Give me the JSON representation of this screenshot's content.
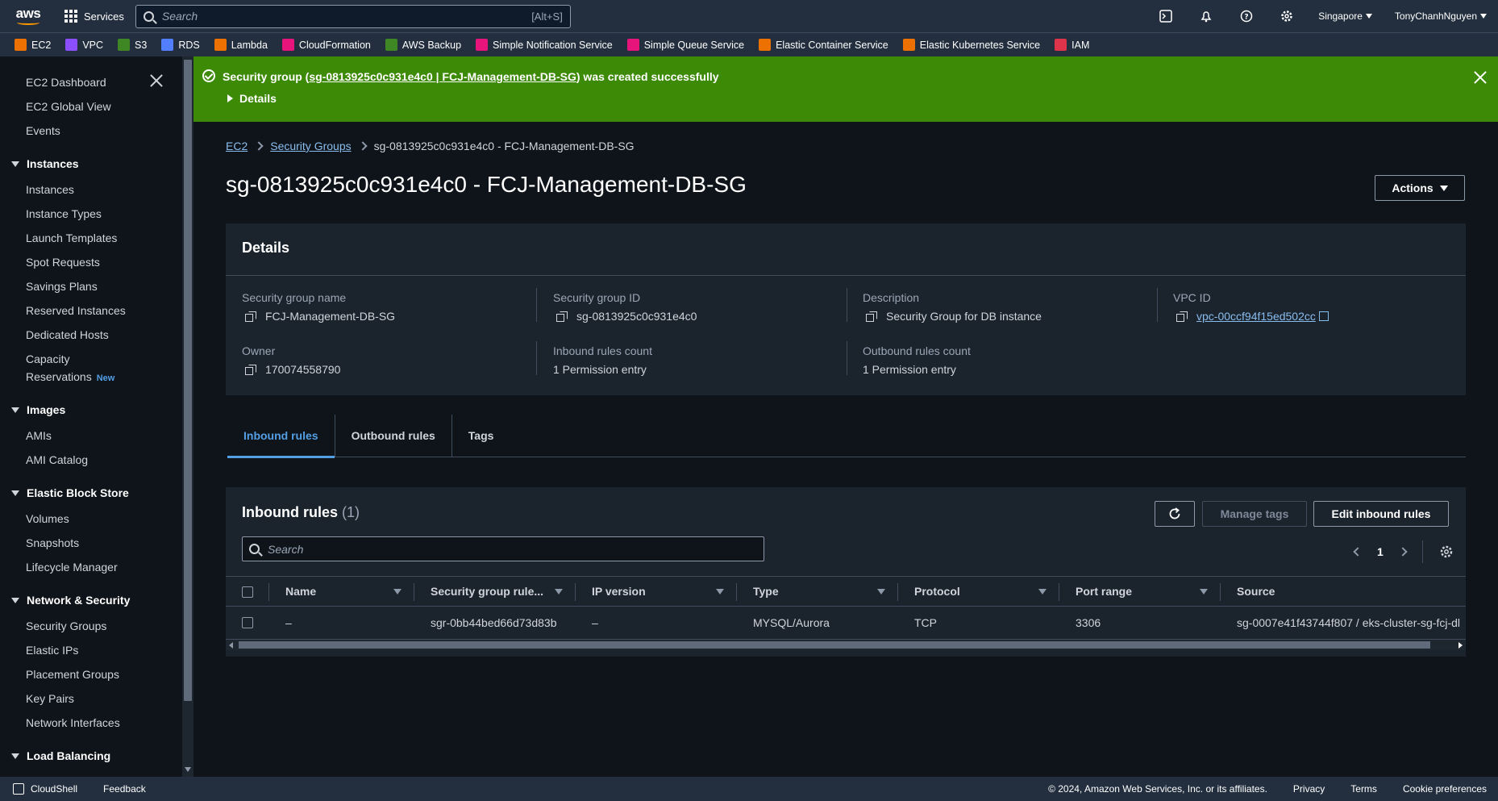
{
  "topbar": {
    "logo": "aws",
    "services_label": "Services",
    "search_placeholder": "Search",
    "search_shortcut": "[Alt+S]",
    "region": "Singapore",
    "user": "TonyChanhNguyen"
  },
  "favorites": [
    {
      "label": "EC2",
      "color": "#ed7100"
    },
    {
      "label": "VPC",
      "color": "#8c4fff"
    },
    {
      "label": "S3",
      "color": "#3f8624"
    },
    {
      "label": "RDS",
      "color": "#527fff"
    },
    {
      "label": "Lambda",
      "color": "#ed7100"
    },
    {
      "label": "CloudFormation",
      "color": "#e7157b"
    },
    {
      "label": "AWS Backup",
      "color": "#3f8624"
    },
    {
      "label": "Simple Notification Service",
      "color": "#e7157b"
    },
    {
      "label": "Simple Queue Service",
      "color": "#e7157b"
    },
    {
      "label": "Elastic Container Service",
      "color": "#ed7100"
    },
    {
      "label": "Elastic Kubernetes Service",
      "color": "#ed7100"
    },
    {
      "label": "IAM",
      "color": "#dd344c"
    }
  ],
  "sidebar": {
    "top_items": [
      "EC2 Dashboard",
      "EC2 Global View",
      "Events"
    ],
    "sections": [
      {
        "title": "Instances",
        "items": [
          "Instances",
          "Instance Types",
          "Launch Templates",
          "Spot Requests",
          "Savings Plans",
          "Reserved Instances",
          "Dedicated Hosts",
          "Capacity",
          "Reservations"
        ]
      },
      {
        "title": "Images",
        "items": [
          "AMIs",
          "AMI Catalog"
        ]
      },
      {
        "title": "Elastic Block Store",
        "items": [
          "Volumes",
          "Snapshots",
          "Lifecycle Manager"
        ]
      },
      {
        "title": "Network & Security",
        "items": [
          "Security Groups",
          "Elastic IPs",
          "Placement Groups",
          "Key Pairs",
          "Network Interfaces"
        ]
      },
      {
        "title": "Load Balancing",
        "items": []
      }
    ],
    "new_badge": "New"
  },
  "flash": {
    "prefix": "Security group (",
    "link": "sg-0813925c0c931e4c0 | FCJ-Management-DB-SG",
    "suffix": ") was created successfully",
    "details": "Details",
    "color": "#3d8a07"
  },
  "breadcrumb": {
    "items": [
      "EC2",
      "Security Groups"
    ],
    "current": "sg-0813925c0c931e4c0 - FCJ-Management-DB-SG"
  },
  "page_title": "sg-0813925c0c931e4c0 - FCJ-Management-DB-SG",
  "actions_label": "Actions",
  "details": {
    "heading": "Details",
    "sg_name_label": "Security group name",
    "sg_name": "FCJ-Management-DB-SG",
    "sg_id_label": "Security group ID",
    "sg_id": "sg-0813925c0c931e4c0",
    "description_label": "Description",
    "description": "Security Group for DB instance",
    "vpc_label": "VPC ID",
    "vpc_id": "vpc-00ccf94f15ed502cc",
    "owner_label": "Owner",
    "owner": "170074558790",
    "inbound_count_label": "Inbound rules count",
    "inbound_count": "1 Permission entry",
    "outbound_count_label": "Outbound rules count",
    "outbound_count": "1 Permission entry"
  },
  "tabs": [
    "Inbound rules",
    "Outbound rules",
    "Tags"
  ],
  "inbound": {
    "heading": "Inbound rules",
    "count": "(1)",
    "manage_tags": "Manage tags",
    "edit": "Edit inbound rules",
    "search_placeholder": "Search",
    "page": "1",
    "columns": [
      "Name",
      "Security group rule...",
      "IP version",
      "Type",
      "Protocol",
      "Port range",
      "Source"
    ],
    "rows": [
      {
        "name": "–",
        "rule_id": "sgr-0bb44bed66d73d83b",
        "ip_version": "–",
        "type": "MYSQL/Aurora",
        "protocol": "TCP",
        "port_range": "3306",
        "source": "sg-0007e41f43744f807 / eks-cluster-sg-fcj-dl"
      }
    ]
  },
  "footer": {
    "cloudshell": "CloudShell",
    "feedback": "Feedback",
    "copyright": "© 2024, Amazon Web Services, Inc. or its affiliates.",
    "privacy": "Privacy",
    "terms": "Terms",
    "cookies": "Cookie preferences"
  }
}
